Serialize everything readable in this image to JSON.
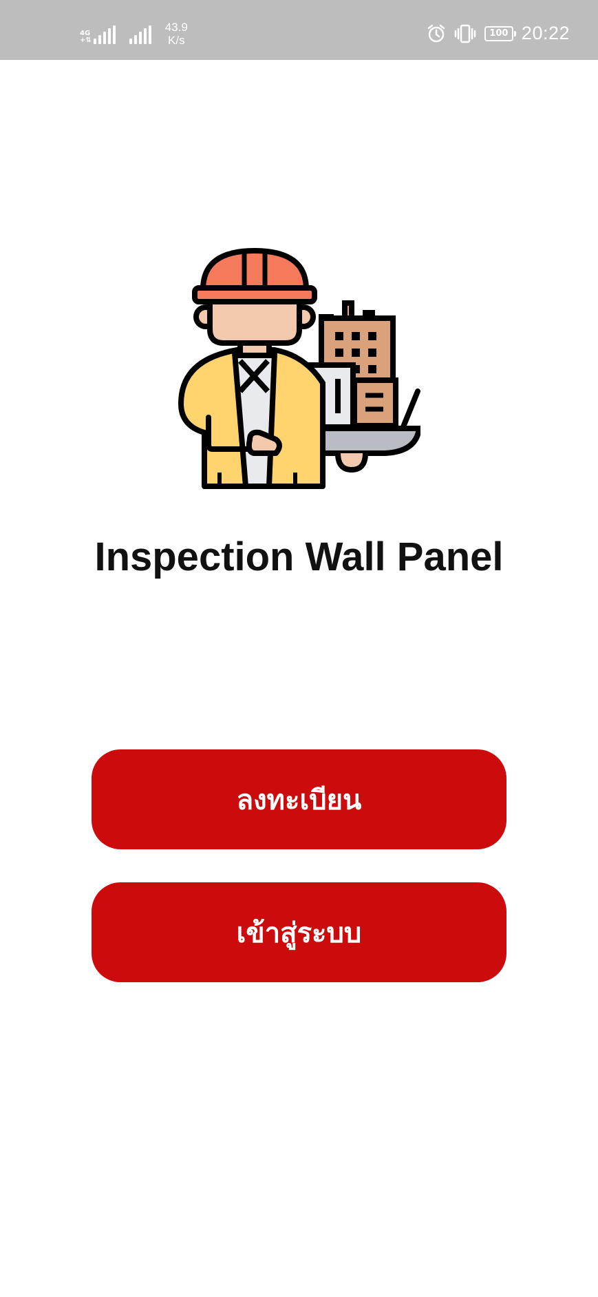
{
  "status_bar": {
    "network_type": "4G",
    "network_sub": "+⇅",
    "speed_value": "43.9",
    "speed_unit": "K/s",
    "battery_level": "100",
    "time": "20:22"
  },
  "app": {
    "title": "Inspection Wall Panel"
  },
  "actions": {
    "register_label": "ลงทะเบียน",
    "login_label": "เข้าสู่ระบบ"
  },
  "colors": {
    "primary_button": "#cc0c0c",
    "status_bar_bg": "#bdbdbd"
  }
}
